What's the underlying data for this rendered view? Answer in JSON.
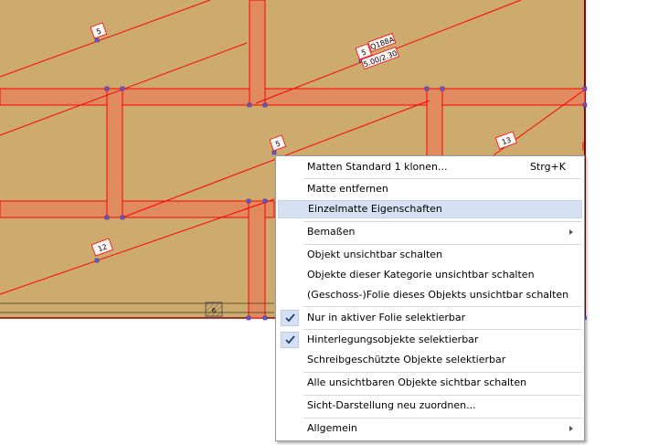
{
  "canvas": {
    "background": "#cdab6e",
    "line_color": "#ff0000",
    "strip_color": "#e08a60",
    "labels": {
      "l1": "5",
      "l2": "5",
      "l3": "Q188A",
      "l4": "5.00/2.30",
      "l5": "5",
      "l6": "13",
      "l7": "12",
      "l8": "6"
    }
  },
  "menu": {
    "items": [
      {
        "label": "Matten Standard 1 klonen...",
        "shortcut": "Strg+K"
      },
      {
        "label": "Matte entfernen"
      },
      {
        "label": "Einzelmatte Eigenschaften",
        "highlighted": true
      },
      {
        "label": "Bemaßen",
        "submenu": true
      },
      {
        "label": "Objekt unsichtbar schalten"
      },
      {
        "label": "Objekte dieser Kategorie unsichtbar schalten"
      },
      {
        "label": "(Geschoss-)Folie dieses Objekts unsichtbar schalten"
      },
      {
        "label": "Nur in aktiver Folie selektierbar",
        "checked": true
      },
      {
        "label": "Hinterlegungsobjekte selektierbar",
        "checked": true
      },
      {
        "label": "Schreibgeschützte Objekte selektierbar"
      },
      {
        "label": "Alle unsichtbaren Objekte sichtbar schalten"
      },
      {
        "label": "Sicht-Darstellung neu zuordnen..."
      },
      {
        "label": "Allgemein",
        "submenu": true
      }
    ]
  }
}
